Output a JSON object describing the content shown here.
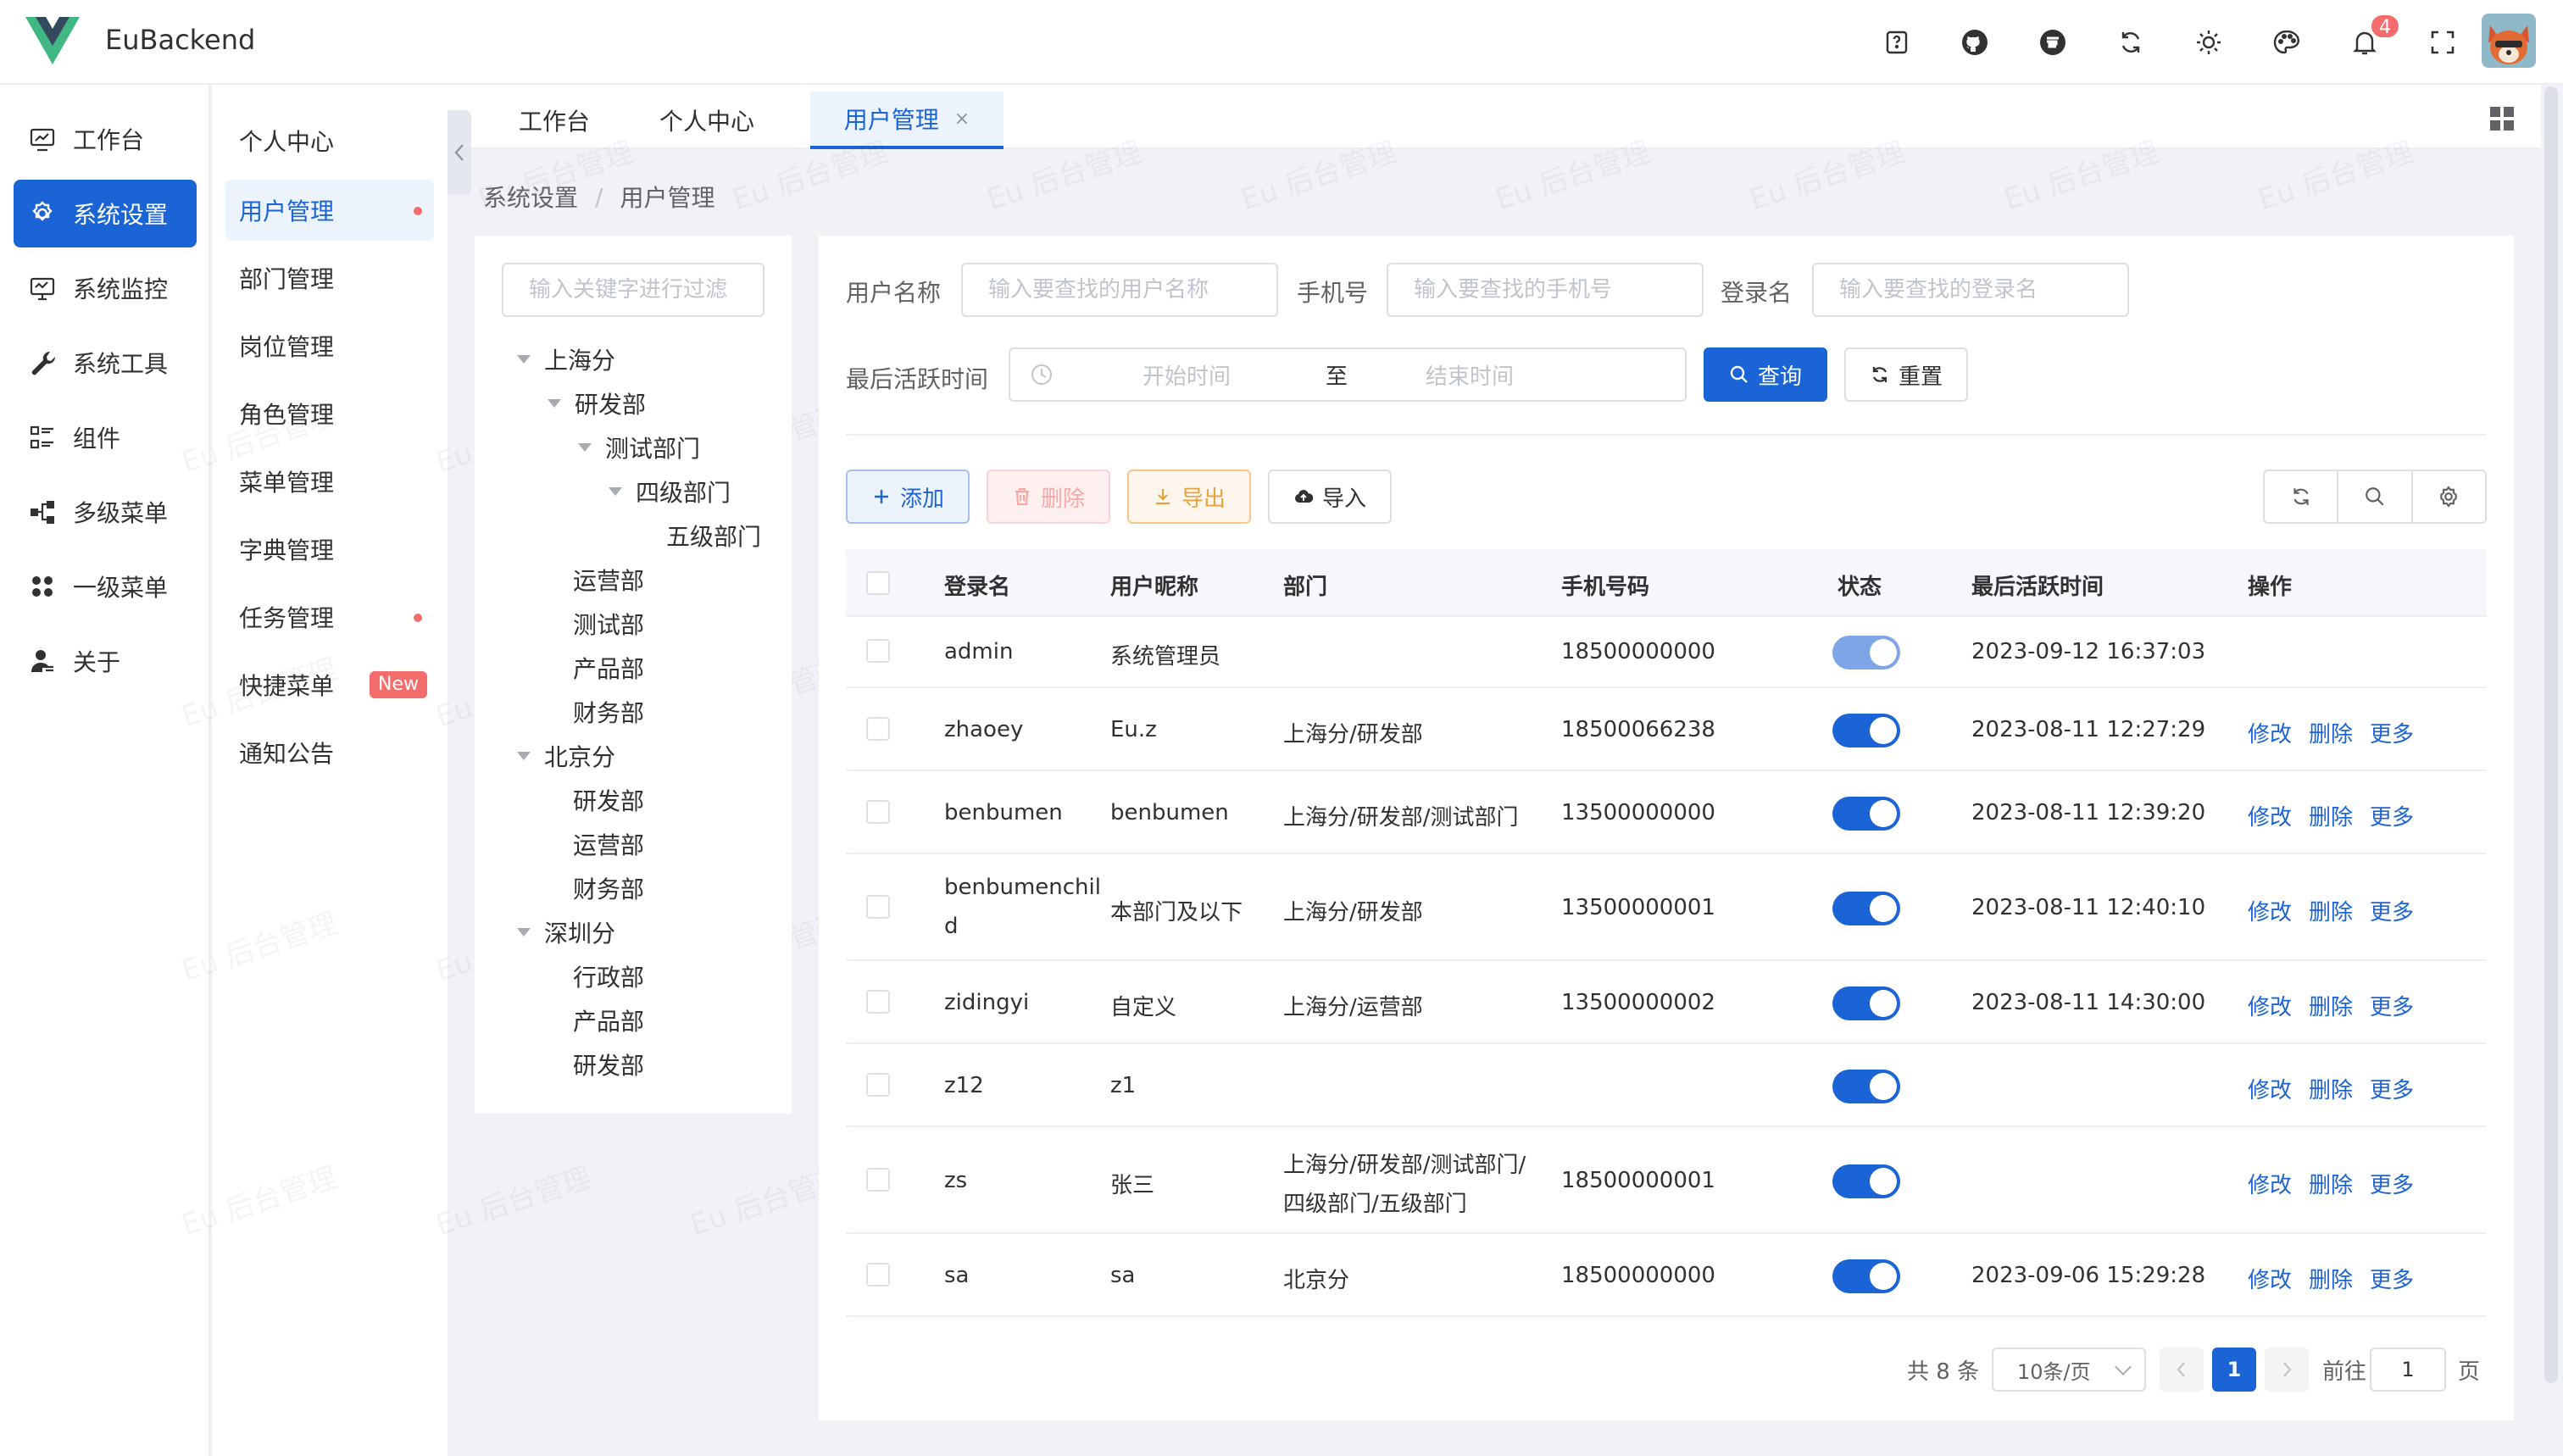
{
  "app": {
    "title": "EuBackend",
    "notification_count": "4"
  },
  "header": {
    "tools": [
      "help-icon",
      "github-icon",
      "gitee-icon",
      "refresh-icon",
      "sun-icon",
      "palette-icon",
      "bell-icon",
      "fullscreen-icon"
    ]
  },
  "sidebar": {
    "items": [
      {
        "label": "工作台",
        "icon": "monitor-chart-icon"
      },
      {
        "label": "系统设置",
        "icon": "gear-icon",
        "active": true
      },
      {
        "label": "系统监控",
        "icon": "monitor-icon"
      },
      {
        "label": "系统工具",
        "icon": "wrench-icon"
      },
      {
        "label": "组件",
        "icon": "list-icon"
      },
      {
        "label": "多级菜单",
        "icon": "tree-icon"
      },
      {
        "label": "一级菜单",
        "icon": "grid-icon"
      },
      {
        "label": "关于",
        "icon": "user-icon"
      }
    ]
  },
  "submenu": {
    "items": [
      {
        "label": "个人中心"
      },
      {
        "label": "用户管理",
        "active": true,
        "dot": true
      },
      {
        "label": "部门管理"
      },
      {
        "label": "岗位管理"
      },
      {
        "label": "角色管理"
      },
      {
        "label": "菜单管理"
      },
      {
        "label": "字典管理"
      },
      {
        "label": "任务管理",
        "dot": true
      },
      {
        "label": "快捷菜单",
        "badge": "New"
      },
      {
        "label": "通知公告"
      }
    ]
  },
  "tabs": [
    {
      "label": "工作台"
    },
    {
      "label": "个人中心"
    },
    {
      "label": "用户管理",
      "active": true,
      "close": "×"
    }
  ],
  "breadcrumb": {
    "items": [
      "系统设置",
      "用户管理"
    ],
    "separator": "/"
  },
  "tree": {
    "filter_placeholder": "输入关键字进行过滤",
    "nodes": [
      {
        "label": "上海分",
        "level": 0,
        "expanded": true
      },
      {
        "label": "研发部",
        "level": 1,
        "expanded": true
      },
      {
        "label": "测试部门",
        "level": 2,
        "expanded": true
      },
      {
        "label": "四级部门",
        "level": 3,
        "expanded": true
      },
      {
        "label": "五级部门",
        "level": 4
      },
      {
        "label": "运营部",
        "level": 1
      },
      {
        "label": "测试部",
        "level": 1
      },
      {
        "label": "产品部",
        "level": 1
      },
      {
        "label": "财务部",
        "level": 1
      },
      {
        "label": "北京分",
        "level": 0,
        "expanded": true
      },
      {
        "label": "研发部",
        "level": 1
      },
      {
        "label": "运营部",
        "level": 1
      },
      {
        "label": "财务部",
        "level": 1
      },
      {
        "label": "深圳分",
        "level": 0,
        "expanded": true
      },
      {
        "label": "行政部",
        "level": 1
      },
      {
        "label": "产品部",
        "level": 1
      },
      {
        "label": "研发部",
        "level": 1
      }
    ]
  },
  "search": {
    "username_label": "用户名称",
    "username_placeholder": "输入要查找的用户名称",
    "phone_label": "手机号",
    "phone_placeholder": "输入要查找的手机号",
    "login_label": "登录名",
    "login_placeholder": "输入要查找的登录名",
    "active_time_label": "最后活跃时间",
    "start_placeholder": "开始时间",
    "range_to": "至",
    "end_placeholder": "结束时间",
    "query_btn": "查询",
    "reset_btn": "重置"
  },
  "toolbar": {
    "add": "添加",
    "delete": "删除",
    "export": "导出",
    "import": "导入"
  },
  "table": {
    "columns": [
      "登录名",
      "用户昵称",
      "部门",
      "手机号码",
      "状态",
      "最后活跃时间",
      "操作"
    ],
    "actions": [
      "修改",
      "删除",
      "更多"
    ],
    "rows": [
      {
        "login": "admin",
        "nick": "系统管理员",
        "dept": "",
        "dept2": "",
        "phone": "18500000000",
        "status": "on-disabled",
        "time": "2023-09-12 16:37:03",
        "ops": false
      },
      {
        "login": "zhaoey",
        "nick": "Eu.z",
        "dept": "上海分/研发部",
        "dept2": "",
        "phone": "18500066238",
        "status": "on",
        "time": "2023-08-11 12:27:29",
        "ops": true
      },
      {
        "login": "benbumen",
        "nick": "benbumen",
        "dept": "上海分/研发部/测试部门",
        "dept2": "",
        "phone": "13500000000",
        "status": "on",
        "time": "2023-08-11 12:39:20",
        "ops": true
      },
      {
        "login": "benbumenchil",
        "login2": "d",
        "nick": "本部门及以下",
        "dept": "上海分/研发部",
        "dept2": "",
        "phone": "13500000001",
        "status": "on",
        "time": "2023-08-11 12:40:10",
        "ops": true
      },
      {
        "login": "zidingyi",
        "nick": "自定义",
        "dept": "上海分/运营部",
        "dept2": "",
        "phone": "13500000002",
        "status": "on",
        "time": "2023-08-11 14:30:00",
        "ops": true
      },
      {
        "login": "z12",
        "nick": "z1",
        "dept": "",
        "dept2": "",
        "phone": "",
        "status": "on",
        "time": "",
        "ops": true
      },
      {
        "login": "zs",
        "nick": "张三",
        "dept": "上海分/研发部/测试部门/",
        "dept2": "四级部门/五级部门",
        "phone": "18500000001",
        "status": "on",
        "time": "",
        "ops": true
      },
      {
        "login": "sa",
        "nick": "sa",
        "dept": "北京分",
        "dept2": "",
        "phone": "18500000000",
        "status": "on",
        "time": "2023-09-06 15:29:28",
        "ops": true
      }
    ]
  },
  "pagination": {
    "total_text": "共 8 条",
    "page_size": "10条/页",
    "current": "1",
    "goto_label": "前往",
    "goto_value": "1",
    "page_suffix": "页"
  },
  "watermark": "Eu 后台管理",
  "colors": {
    "primary": "#1a64d6",
    "danger": "#f56c6c",
    "warning": "#e6a23c"
  }
}
